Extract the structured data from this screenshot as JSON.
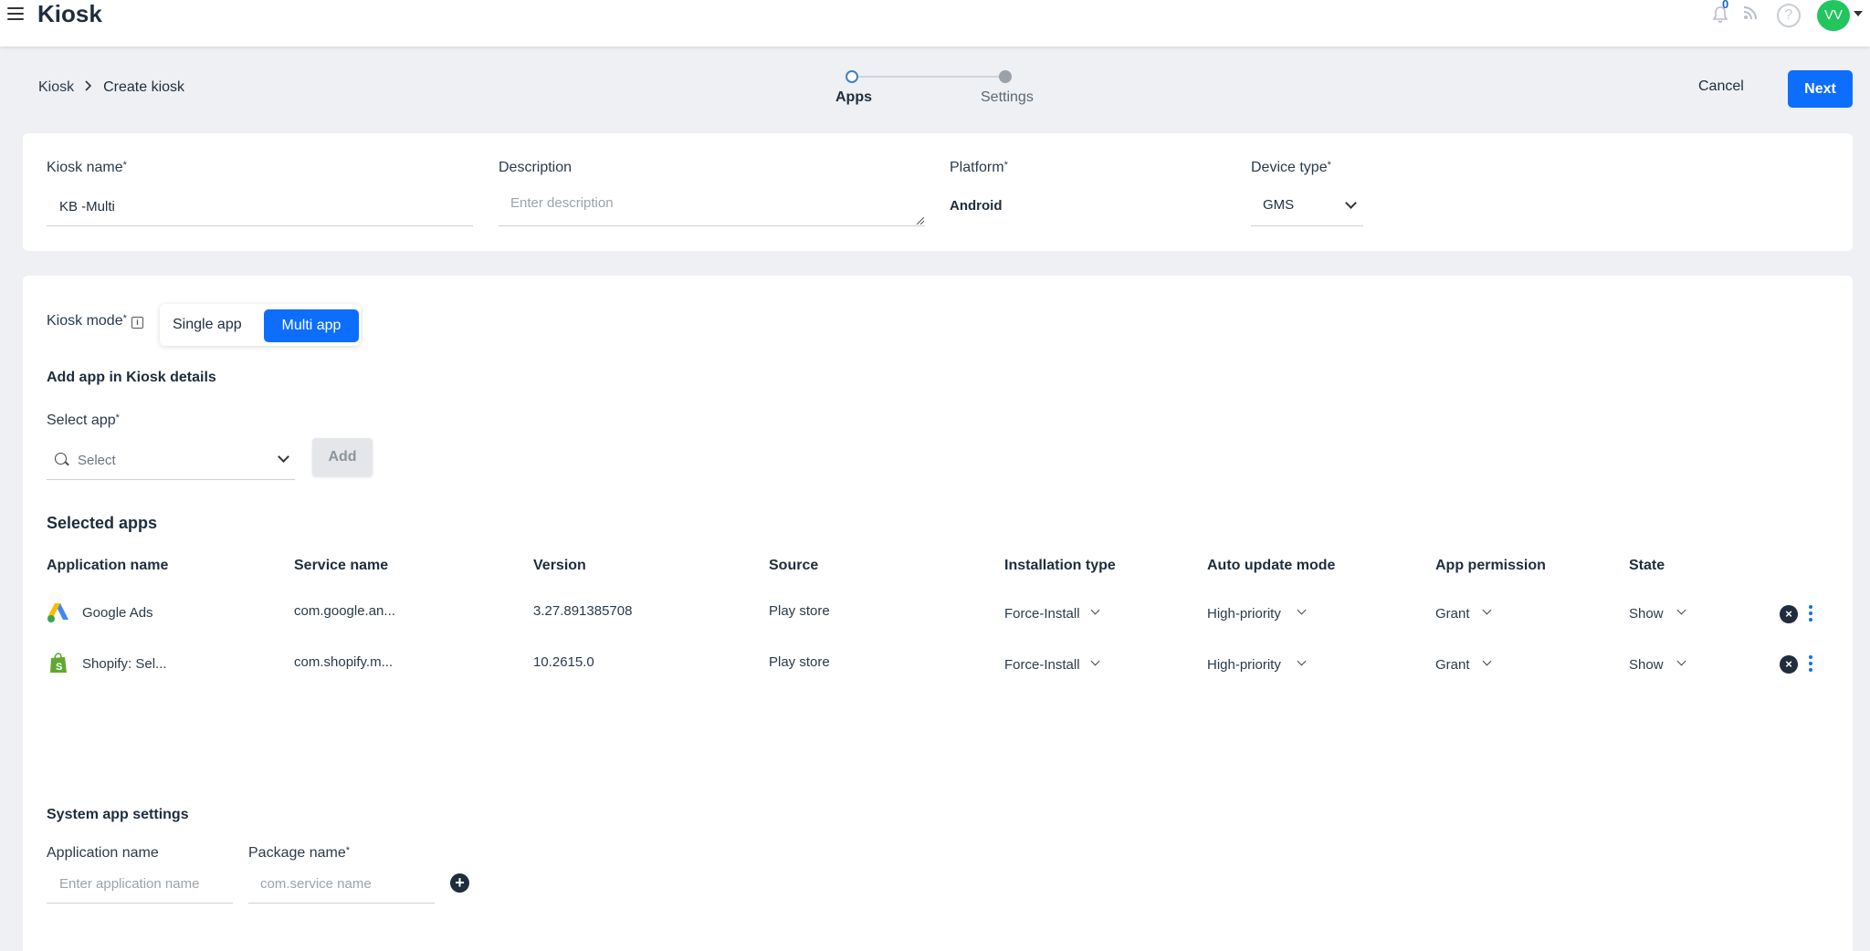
{
  "topbar": {
    "title": "Kiosk",
    "notification_count": "0",
    "avatar_initials": "VV",
    "icons": [
      "hamburger-menu-icon",
      "bell-icon",
      "rss-icon",
      "help-icon",
      "chevron-down-icon"
    ]
  },
  "breadcrumb": {
    "root": "Kiosk",
    "current": "Create kiosk"
  },
  "stepper": {
    "steps": [
      {
        "label": "Apps",
        "active": true
      },
      {
        "label": "Settings",
        "active": false
      }
    ]
  },
  "actions": {
    "cancel": "Cancel",
    "next": "Next"
  },
  "kiosk_form": {
    "name_label": "Kiosk name",
    "name_value": "KB -Multi",
    "description_label": "Description",
    "description_placeholder": "Enter description",
    "platform_label": "Platform",
    "platform_value": "Android",
    "device_type_label": "Device type",
    "device_type_value": "GMS",
    "required_mark": "*"
  },
  "mode": {
    "label": "Kiosk mode",
    "info_icon": "i",
    "single": "Single app",
    "multi": "Multi app",
    "selected": "Multi app"
  },
  "add_app": {
    "title": "Add app in Kiosk details",
    "select_label": "Select app",
    "select_placeholder": "Select",
    "add_button": "Add"
  },
  "selected_apps": {
    "title": "Selected apps",
    "columns": [
      "Application name",
      "Service name",
      "Version",
      "Source",
      "Installation type",
      "Auto update mode",
      "App permission",
      "State"
    ],
    "rows": [
      {
        "icon": "google-ads-icon",
        "name": "Google Ads",
        "service": "com.google.an...",
        "version": "3.27.891385708",
        "source": "Play store",
        "installation": "Force-Install",
        "auto_update": "High-priority",
        "permission": "Grant",
        "state": "Show"
      },
      {
        "icon": "shopify-icon",
        "name": "Shopify: Sel...",
        "service": "com.shopify.m...",
        "version": "10.2615.0",
        "source": "Play store",
        "installation": "Force-Install",
        "auto_update": "High-priority",
        "permission": "Grant",
        "state": "Show"
      }
    ]
  },
  "system_app": {
    "title": "System app settings",
    "app_name_label": "Application name",
    "app_name_placeholder": "Enter application name",
    "package_label": "Package name",
    "package_placeholder": "com.service name",
    "add_icon": "+"
  },
  "colors": {
    "primary": "#0d6efd",
    "avatar": "#22c55e",
    "background": "#eef0f3"
  }
}
